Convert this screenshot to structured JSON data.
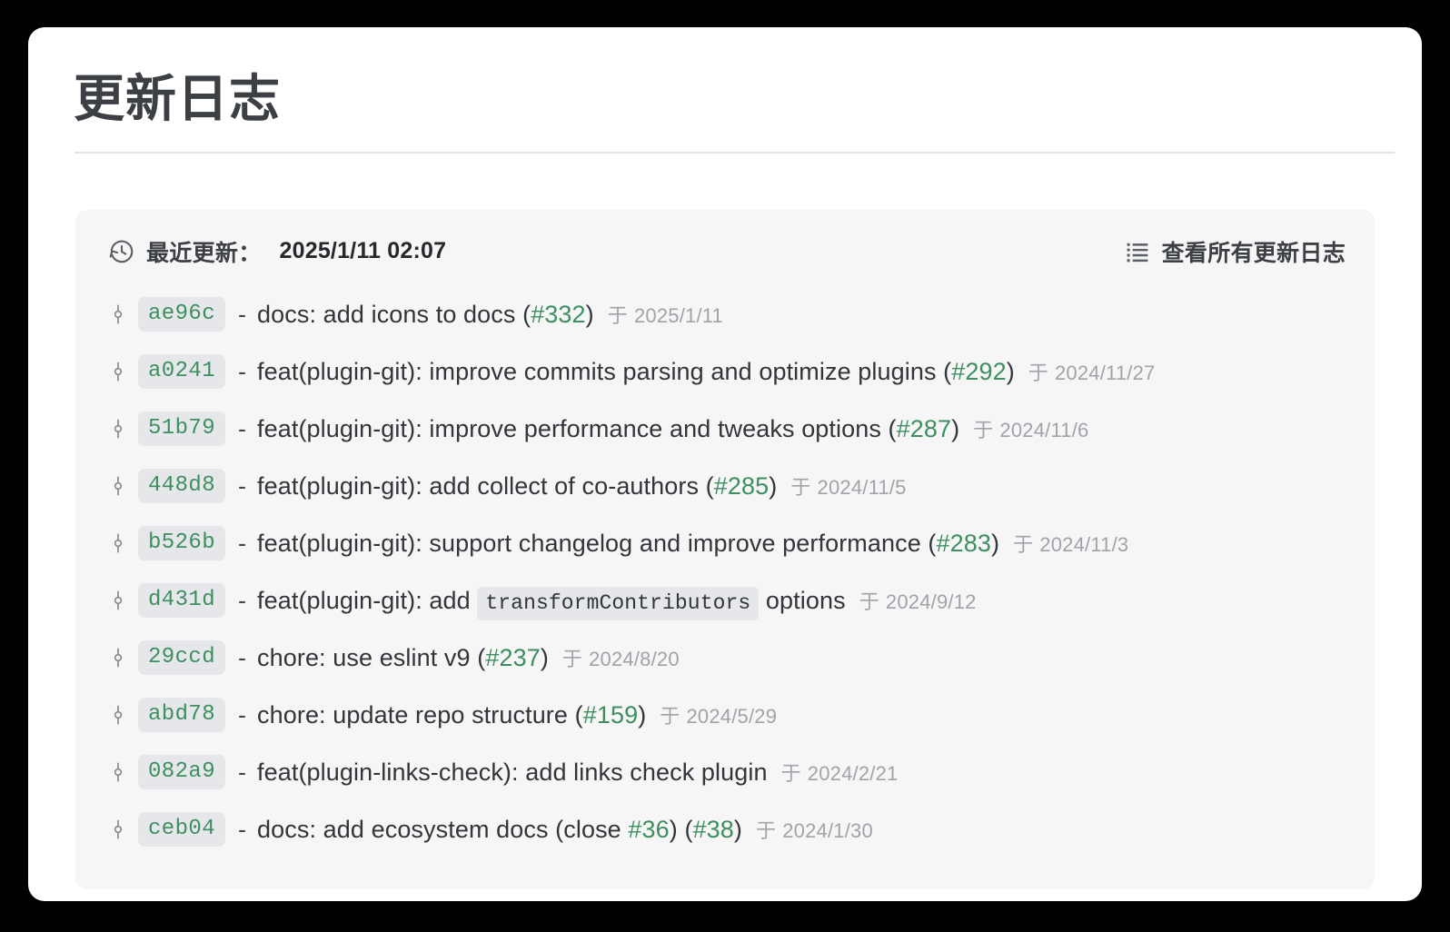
{
  "page": {
    "title": "更新日志",
    "background_color": "#000000",
    "card_color": "#ffffff",
    "panel_color": "#f6f6f7",
    "accent_green": "#3e8f5f"
  },
  "panel": {
    "clock_icon": "history-clock-icon",
    "updated_label": "最近更新：",
    "updated_time": "2025/1/11 02:07",
    "list_icon": "list-icon",
    "view_all_label": "查看所有更新日志"
  },
  "commits": [
    {
      "icon": "git-commit-icon",
      "hash": "ae96c",
      "dash": "-",
      "message_before": "docs: add icons to docs (",
      "pr": "#332",
      "message_after": ")",
      "at": "于",
      "date": "2025/1/11"
    },
    {
      "icon": "git-commit-icon",
      "hash": "a0241",
      "dash": "-",
      "message_before": "feat(plugin-git): improve commits parsing and optimize plugins (",
      "pr": "#292",
      "message_after": ")",
      "at": "于",
      "date": "2024/11/27"
    },
    {
      "icon": "git-commit-icon",
      "hash": "51b79",
      "dash": "-",
      "message_before": "feat(plugin-git): improve performance and tweaks options (",
      "pr": "#287",
      "message_after": ")",
      "at": "于",
      "date": "2024/11/6"
    },
    {
      "icon": "git-commit-icon",
      "hash": "448d8",
      "dash": "-",
      "message_before": "feat(plugin-git): add collect of co-authors (",
      "pr": "#285",
      "message_after": ")",
      "at": "于",
      "date": "2024/11/5"
    },
    {
      "icon": "git-commit-icon",
      "hash": "b526b",
      "dash": "-",
      "message_before": "feat(plugin-git): support changelog and improve performance (",
      "pr": "#283",
      "message_after": ")",
      "at": "于",
      "date": "2024/11/3"
    },
    {
      "icon": "git-commit-icon",
      "hash": "d431d",
      "dash": "-",
      "message_before": "feat(plugin-git): add ",
      "code": "transformContributors",
      "message_after": " options",
      "at": "于",
      "date": "2024/9/12"
    },
    {
      "icon": "git-commit-icon",
      "hash": "29ccd",
      "dash": "-",
      "message_before": "chore: use eslint v9 (",
      "pr": "#237",
      "message_after": ")",
      "at": "于",
      "date": "2024/8/20"
    },
    {
      "icon": "git-commit-icon",
      "hash": "abd78",
      "dash": "-",
      "message_before": "chore: update repo structure (",
      "pr": "#159",
      "message_after": ")",
      "at": "于",
      "date": "2024/5/29"
    },
    {
      "icon": "git-commit-icon",
      "hash": "082a9",
      "dash": "-",
      "message_before": "feat(plugin-links-check): add links check plugin",
      "message_after": "",
      "at": "于",
      "date": "2024/2/21"
    },
    {
      "icon": "git-commit-icon",
      "hash": "ceb04",
      "dash": "-",
      "message_before": "docs: add ecosystem docs (close ",
      "pr": "#36",
      "message_mid": ") (",
      "pr2": "#38",
      "message_after": ")",
      "at": "于",
      "date": "2024/1/30"
    }
  ]
}
